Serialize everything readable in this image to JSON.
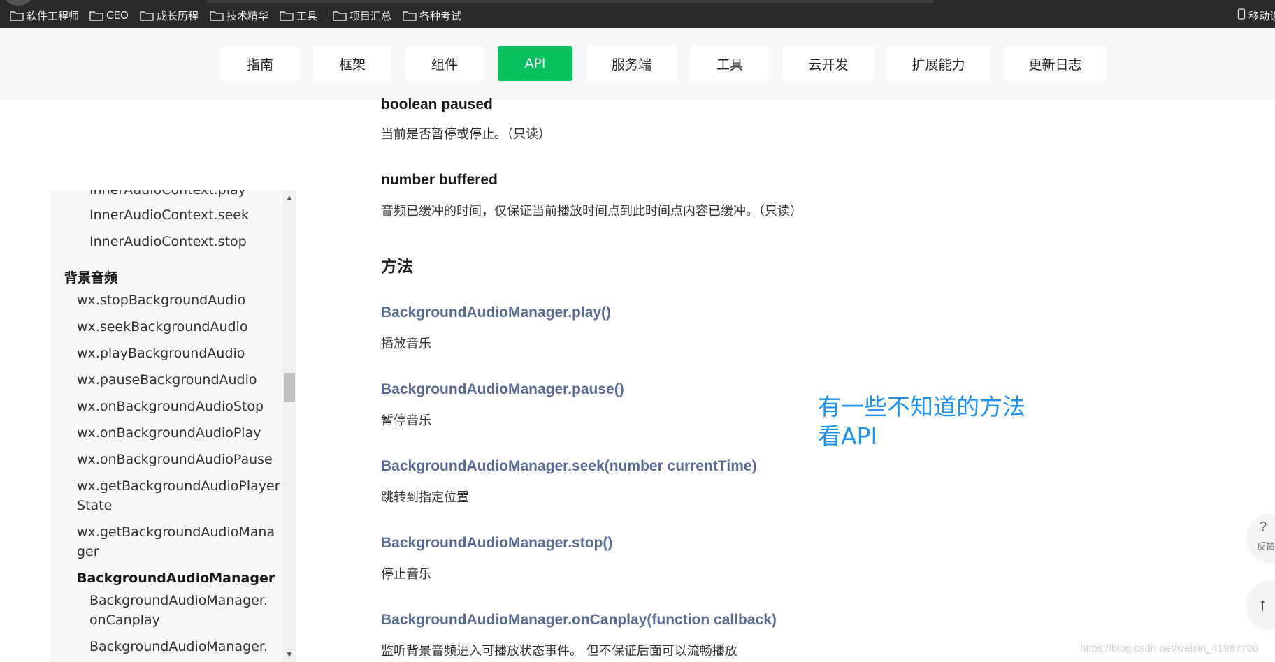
{
  "bookmarks": {
    "items": [
      {
        "label": "软件工程师",
        "icon": "folder-icon"
      },
      {
        "label": "CEO",
        "icon": "folder-icon"
      },
      {
        "label": "成长历程",
        "icon": "folder-icon"
      },
      {
        "label": "技术精华",
        "icon": "folder-icon"
      },
      {
        "label": "工具",
        "icon": "folder-icon"
      },
      {
        "label": "项目汇总",
        "icon": "folder-icon"
      },
      {
        "label": "各种考试",
        "icon": "folder-icon"
      }
    ],
    "right_label": "移动设"
  },
  "nav": {
    "tabs": [
      {
        "label": "指南"
      },
      {
        "label": "框架"
      },
      {
        "label": "组件"
      },
      {
        "label": "API",
        "active": true
      },
      {
        "label": "服务端"
      },
      {
        "label": "工具"
      },
      {
        "label": "云开发"
      },
      {
        "label": "扩展能力"
      },
      {
        "label": "更新日志"
      }
    ],
    "active_color": "#07c160"
  },
  "sidebar": {
    "items": [
      {
        "label": "InnerAudioContext.play",
        "level": 2
      },
      {
        "label": "InnerAudioContext.seek",
        "level": 2
      },
      {
        "label": "InnerAudioContext.stop",
        "level": 2
      },
      {
        "label": "背景音频",
        "level": 0
      },
      {
        "label": "wx.stopBackgroundAudio",
        "level": 1
      },
      {
        "label": "wx.seekBackgroundAudio",
        "level": 1
      },
      {
        "label": "wx.playBackgroundAudio",
        "level": 1
      },
      {
        "label": "wx.pauseBackgroundAudio",
        "level": 1
      },
      {
        "label": "wx.onBackgroundAudioStop",
        "level": 1
      },
      {
        "label": "wx.onBackgroundAudioPlay",
        "level": 1
      },
      {
        "label": "wx.onBackgroundAudioPause",
        "level": 1
      },
      {
        "label": "wx.getBackgroundAudioPlayer",
        "level": 1
      },
      {
        "label": "State",
        "level": 1
      },
      {
        "label": "wx.getBackgroundAudioMana",
        "level": 1
      },
      {
        "label": "ger",
        "level": 1
      },
      {
        "label": "BackgroundAudioManager",
        "level": 1
      },
      {
        "label": "BackgroundAudioManager.",
        "level": 2
      },
      {
        "label": "onCanplay",
        "level": 2
      },
      {
        "label": "BackgroundAudioManager.",
        "level": 2
      }
    ]
  },
  "content": {
    "prop1_title": "boolean paused",
    "prop1_desc": "当前是否暂停或停止。（只读）",
    "prop2_title": "number buffered",
    "prop2_desc": "音频已缓冲的时间，仅保证当前播放时间点到此时间点内容已缓冲。（只读）",
    "section_title": "方法",
    "methods": [
      {
        "name": "BackgroundAudioManager.play()",
        "desc": "播放音乐"
      },
      {
        "name": "BackgroundAudioManager.pause()",
        "desc": "暂停音乐"
      },
      {
        "name": "BackgroundAudioManager.seek(number currentTime)",
        "desc": "跳转到指定位置"
      },
      {
        "name": "BackgroundAudioManager.stop()",
        "desc": "停止音乐"
      },
      {
        "name": "BackgroundAudioManager.onCanplay(function callback)",
        "desc": "监听背景音频进入可播放状态事件。 但不保证后面可以流畅播放"
      }
    ],
    "link_color": "#576b95"
  },
  "annotation": {
    "line1": "有一些不知道的方法",
    "line2": "看API",
    "color": "#1e90ee"
  },
  "floating": {
    "feedback_symbol": "?",
    "feedback_label": "反馈",
    "top_symbol": "↑"
  },
  "watermark": "https://blog.csdn.net/weixin_41987706"
}
